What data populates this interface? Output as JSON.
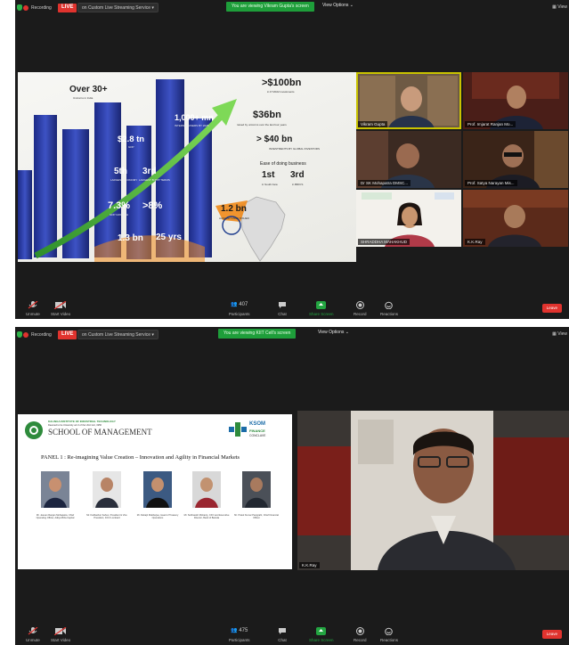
{
  "meeting1": {
    "topbar": {
      "recording_label": "Recording",
      "live_label": "LIVE",
      "live_on": "on Custom Live Streaming Service",
      "viewing_notice": "You are viewing Vikram Gupta's screen",
      "view_options": "View Options",
      "view_right": "View"
    },
    "slide": {
      "over30": "Over 30+",
      "over30_sub": "Unicorns in India",
      "usd100bn": ">$100bn",
      "usd100bn_sub": "in FY2022 investments",
      "mn1000": "1,000+ mn",
      "mn1000_sub": "INTERNET USERS BY 2025",
      "usd36bn": "$36bn",
      "usd36bn_sub": "raised by unicorns over the last four years",
      "tn28": "$2.8 tn",
      "gdp_label": "GDP",
      "usd40bn": "> $40 bn",
      "usd40bn_sub": "INVESTMENTS BY GLOBAL INVESTORS",
      "fifth": "5th",
      "fifth_sub": "LARGEST ECONOMY",
      "third": "3rd",
      "third_sub": "LARGEST B PPP TERMS",
      "ease": "Ease of doing business",
      "first": "1st",
      "first_sub": "in South Asia",
      "third2": "3rd",
      "third2_sub": "in BRICS",
      "gdp_growth": "7.3%",
      "gdp_growth_sub": "GDP GROWTH",
      "gt8": ">8%",
      "bn12": "1.2 bn",
      "bn12_sub": "AADHAR CARD ISSUED",
      "bn13": "1.3 bn",
      "yrs25": "25 yrs"
    },
    "gallery": [
      {
        "name": "Vikram Gupta",
        "active": true
      },
      {
        "name": "Prof. Imjarat Ranjan Mo...",
        "active": false
      },
      {
        "name": "Dr SK Mohapatra DMSC...",
        "active": false
      },
      {
        "name": "Prof. Satya Narayan Mis...",
        "active": false
      },
      {
        "name": "SHRADDHA MAHAKHUD",
        "active": false
      },
      {
        "name": "K.K.Ray",
        "active": false
      }
    ],
    "toolbar": {
      "unmute": "Unmute",
      "start_video": "Start Video",
      "participants": "Participants",
      "participant_count": "407",
      "chat": "Chat",
      "share_screen": "Share Screen",
      "record": "Record",
      "reactions": "Reactions",
      "leave": "Leave"
    }
  },
  "meeting2": {
    "topbar": {
      "recording_label": "Recording",
      "live_label": "LIVE",
      "live_on": "on Custom Live Streaming Service",
      "viewing_notice": "You are viewing KIIT Cell's screen",
      "view_options": "View Options",
      "view_right": "View"
    },
    "slide": {
      "institute_line1": "KALINGA INSTITUTE OF INDUSTRIAL TECHNOLOGY",
      "institute_line2": "Deemed to be University u/s 3 of the UGC Act, 1956",
      "school": "SCHOOL OF MANAGEMENT",
      "ksom": "KSOM",
      "finance": "FINANCE",
      "conclave": "CONCLAVE",
      "panel_title": "PANEL 1 : Re-imagining Value Creation – Innovation and Agility in Financial Markets",
      "speakers": [
        {
          "caption": "Mr. Jeevan Ranjan Mohapatra, Chief Operating Officer, Aditya Birla Capital"
        },
        {
          "caption": "Mr. Kalibardun Sahoo, President & Vice President, ICICI Lombard"
        },
        {
          "caption": "Mr. Debajit Mukherjee, Head of Treasury Operations"
        },
        {
          "caption": "Mr. Subhasish Mohanty, CFO and Executive Director, Bank of Baroda"
        },
        {
          "caption": "Mr. Pratul Kumar Panigrahi, Chief Financial Officer"
        }
      ]
    },
    "main_video": {
      "name": "K.K.Ray"
    },
    "toolbar": {
      "unmute": "Unmute",
      "start_video": "Start Video",
      "participants": "Participants",
      "participant_count": "475",
      "chat": "Chat",
      "share_screen": "Share Screen",
      "record": "Record",
      "reactions": "Reactions",
      "leave": "Leave"
    }
  },
  "colors": {
    "zoom_bg": "#1b1b1b",
    "live_red": "#e0332e",
    "viewing_green": "#1e9e3a",
    "share_green": "#23a541",
    "active_speaker": "#c9c300",
    "slide_green_arrow": "#3fae3a",
    "slide_blue": "#2b3c9a",
    "slide_orange": "#f08a1a"
  }
}
